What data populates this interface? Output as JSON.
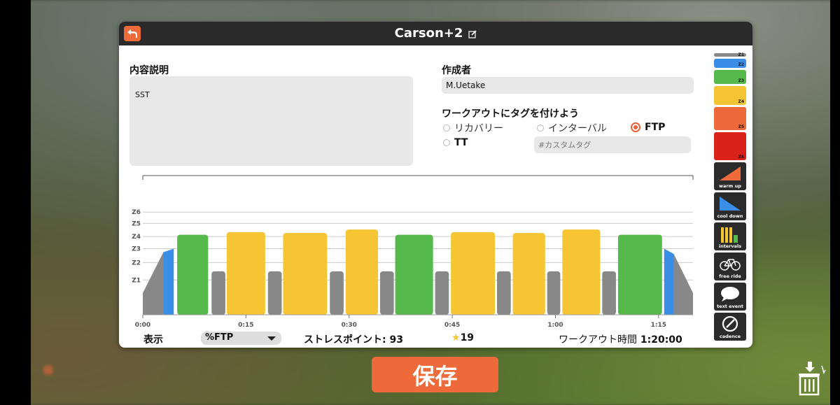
{
  "window": {
    "title": "Carson+2",
    "back_icon": "back-arrow-icon",
    "edit_icon": "edit-icon"
  },
  "description": {
    "label": "内容説明",
    "value": "SST"
  },
  "author": {
    "label": "作成者",
    "value": "M.Uetake"
  },
  "tags": {
    "label": "ワークアウトにタグを付けよう",
    "options": [
      {
        "label": "リカバリー",
        "checked": false
      },
      {
        "label": "インターバル",
        "checked": false
      },
      {
        "label": "FTP",
        "checked": true
      },
      {
        "label": "TT",
        "checked": false
      }
    ],
    "custom_placeholder": "#カスタムタグ"
  },
  "chart_data": {
    "type": "bar",
    "title": "",
    "xlabel": "",
    "ylabel": "",
    "x_unit": "minutes",
    "xlim": [
      0,
      80
    ],
    "x_ticks": [
      "0:00",
      "0:15",
      "0:30",
      "0:45",
      "1:00",
      "1:15"
    ],
    "y_zones": [
      "Z1",
      "Z2",
      "Z3",
      "Z4",
      "Z5",
      "Z6"
    ],
    "y_zone_levels": [
      0.4,
      0.6,
      0.76,
      0.9,
      1.05,
      1.18
    ],
    "ylim": [
      0,
      1.6
    ],
    "segments": [
      {
        "kind": "warmup",
        "start": 0.0,
        "end": 3.0,
        "from": 0.25,
        "to": 0.72,
        "zone": "Z1"
      },
      {
        "kind": "warmup",
        "start": 3.0,
        "end": 4.5,
        "from": 0.72,
        "to": 0.76,
        "zone": "Z2"
      },
      {
        "kind": "steady",
        "start": 5.0,
        "end": 9.5,
        "power": 0.92,
        "zone": "Z3"
      },
      {
        "kind": "steady",
        "start": 10.0,
        "end": 12.0,
        "power": 0.5,
        "zone": "Z1"
      },
      {
        "kind": "steady",
        "start": 12.2,
        "end": 17.8,
        "power": 0.95,
        "zone": "Z4"
      },
      {
        "kind": "steady",
        "start": 18.2,
        "end": 20.2,
        "power": 0.5,
        "zone": "Z1"
      },
      {
        "kind": "steady",
        "start": 20.4,
        "end": 26.8,
        "power": 0.94,
        "zone": "Z4"
      },
      {
        "kind": "steady",
        "start": 27.2,
        "end": 29.2,
        "power": 0.5,
        "zone": "Z1"
      },
      {
        "kind": "steady",
        "start": 29.5,
        "end": 34.2,
        "power": 0.98,
        "zone": "Z4"
      },
      {
        "kind": "steady",
        "start": 34.5,
        "end": 36.5,
        "power": 0.5,
        "zone": "Z1"
      },
      {
        "kind": "steady",
        "start": 36.7,
        "end": 42.2,
        "power": 0.92,
        "zone": "Z3"
      },
      {
        "kind": "steady",
        "start": 42.5,
        "end": 44.5,
        "power": 0.5,
        "zone": "Z1"
      },
      {
        "kind": "steady",
        "start": 44.8,
        "end": 51.2,
        "power": 0.95,
        "zone": "Z4"
      },
      {
        "kind": "steady",
        "start": 51.5,
        "end": 53.5,
        "power": 0.5,
        "zone": "Z1"
      },
      {
        "kind": "steady",
        "start": 53.8,
        "end": 58.5,
        "power": 0.94,
        "zone": "Z4"
      },
      {
        "kind": "steady",
        "start": 58.8,
        "end": 60.7,
        "power": 0.5,
        "zone": "Z1"
      },
      {
        "kind": "steady",
        "start": 61.0,
        "end": 66.5,
        "power": 0.98,
        "zone": "Z4"
      },
      {
        "kind": "steady",
        "start": 66.8,
        "end": 68.8,
        "power": 0.5,
        "zone": "Z1"
      },
      {
        "kind": "steady",
        "start": 69.1,
        "end": 75.5,
        "power": 0.92,
        "zone": "Z3"
      },
      {
        "kind": "cooldown",
        "start": 75.8,
        "end": 77.2,
        "from": 0.76,
        "to": 0.7,
        "zone": "Z2"
      },
      {
        "kind": "cooldown",
        "start": 77.2,
        "end": 80.0,
        "from": 0.7,
        "to": 0.25,
        "zone": "Z1"
      }
    ]
  },
  "bottom": {
    "display_label": "表示",
    "display_value": "%FTP",
    "stress_label": "ストレスポイント:",
    "stress_value": "93",
    "star_icon": "star-icon",
    "stars": "19",
    "duration_label": "ワークアウト時間",
    "duration_value": "1:20:00"
  },
  "palette": {
    "zones": [
      {
        "label": "Z1",
        "color": "#888888"
      },
      {
        "label": "Z2",
        "color": "#3a8ee6"
      },
      {
        "label": "Z3",
        "color": "#56b94c"
      },
      {
        "label": "Z4",
        "color": "#f6c533"
      },
      {
        "label": "Z5",
        "color": "#ee6a3a"
      },
      {
        "label": "Z6",
        "color": "#d9231a"
      }
    ],
    "tools": [
      {
        "label": "warm up",
        "icon": "warmup-icon"
      },
      {
        "label": "cool down",
        "icon": "cooldown-icon"
      },
      {
        "label": "intervals",
        "icon": "intervals-icon"
      },
      {
        "label": "free ride",
        "icon": "bicycle-icon"
      },
      {
        "label": "text event",
        "icon": "speech-bubble-icon"
      },
      {
        "label": "cadence",
        "icon": "cadence-gauge-icon"
      }
    ]
  },
  "save_button": {
    "label": "保存"
  },
  "trash_icon": "trash-download-icon"
}
